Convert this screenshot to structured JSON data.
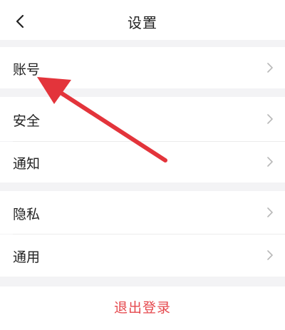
{
  "header": {
    "title": "设置",
    "back_icon": "chevron-left-icon"
  },
  "groups": [
    {
      "items": [
        {
          "label": "账号"
        }
      ]
    },
    {
      "items": [
        {
          "label": "安全"
        },
        {
          "label": "通知"
        }
      ]
    },
    {
      "items": [
        {
          "label": "隐私"
        },
        {
          "label": "通用"
        }
      ]
    }
  ],
  "logout": {
    "label": "退出登录"
  },
  "colors": {
    "logout_text": "#e5484d",
    "annotation_arrow": "#e3343b",
    "background": "#f3f3f5"
  },
  "chevron_icon": "chevron-right-icon"
}
